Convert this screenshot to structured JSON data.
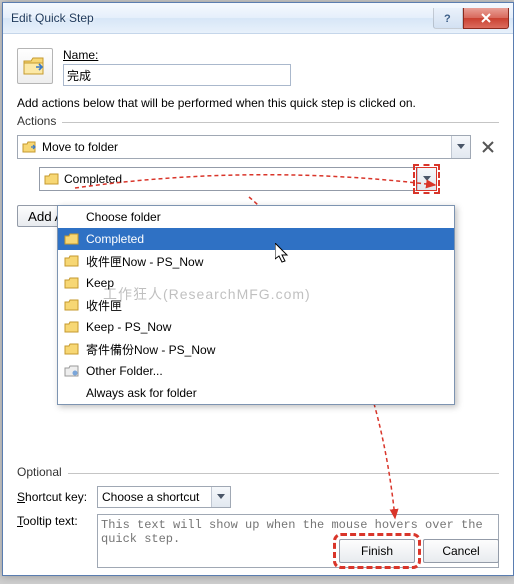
{
  "window": {
    "title": "Edit Quick Step"
  },
  "name_label": "Name:",
  "name_value": "完成",
  "description": "Add actions below that will be performed when this quick step is clicked on.",
  "actions": {
    "label": "Actions",
    "action1": "Move to folder",
    "folder_value": "Completed",
    "add_action_label": "Add Action"
  },
  "dropdown": {
    "items": [
      {
        "label": "Choose folder",
        "icon": "",
        "selected": false
      },
      {
        "label": "Completed",
        "icon": "folder",
        "selected": true
      },
      {
        "label": "收件匣Now - PS_Now",
        "icon": "folder",
        "selected": false
      },
      {
        "label": "Keep",
        "icon": "folder",
        "selected": false
      },
      {
        "label": "收件匣",
        "icon": "folder",
        "selected": false
      },
      {
        "label": "Keep - PS_Now",
        "icon": "folder",
        "selected": false
      },
      {
        "label": "寄件備份Now - PS_Now",
        "icon": "folder",
        "selected": false
      },
      {
        "label": "Other Folder...",
        "icon": "other",
        "selected": false
      },
      {
        "label": "Always ask for folder",
        "icon": "",
        "selected": false
      }
    ]
  },
  "optional": {
    "label": "Optional",
    "shortcut_label": "Shortcut key:",
    "shortcut_value": "Choose a shortcut",
    "tooltip_label": "Tooltip text:",
    "tooltip_placeholder": "This text will show up when the mouse hovers over the quick step."
  },
  "buttons": {
    "finish": "Finish",
    "cancel": "Cancel"
  },
  "watermark": "工作狂人(ResearchMFG.com)",
  "colors": {
    "highlight": "#d9352a",
    "selection": "#2f71c4"
  }
}
